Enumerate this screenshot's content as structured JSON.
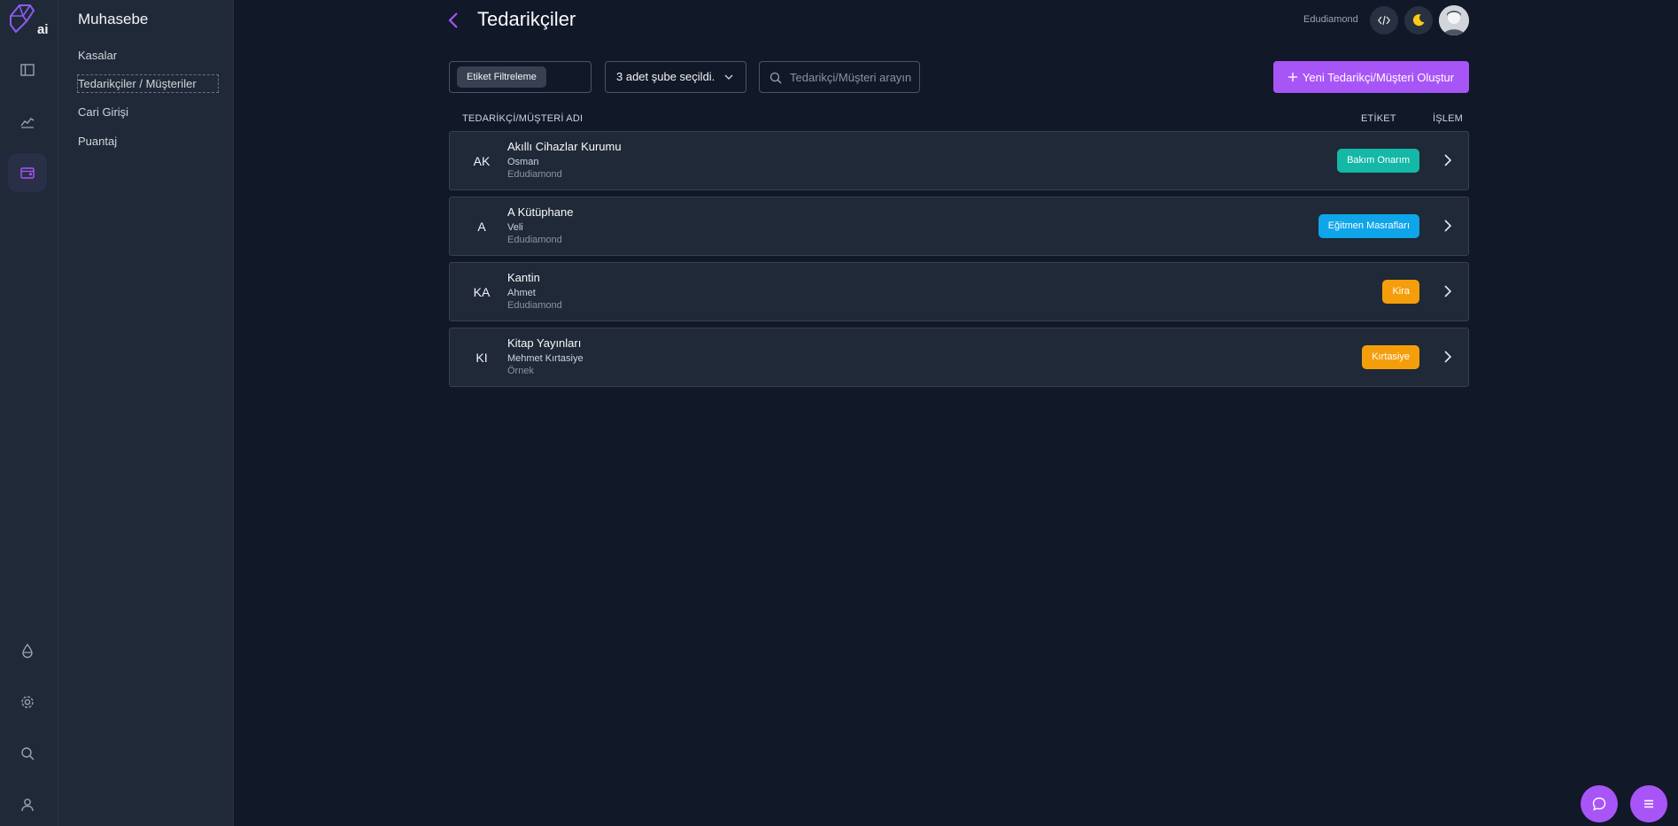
{
  "app": {
    "logo_text": "ai"
  },
  "subnav": {
    "title": "Muhasebe",
    "items": [
      {
        "label": "Kasalar"
      },
      {
        "label": "Tedarikçiler / Müşteriler"
      },
      {
        "label": "Cari Girişi"
      },
      {
        "label": "Puantaj"
      }
    ]
  },
  "header": {
    "title": "Tedarikçiler",
    "org_name": "Edudiamond"
  },
  "toolbar": {
    "tag_filter_label": "Etiket Filtreleme",
    "branch_select_label": "3 adet şube seçildi.",
    "search_placeholder": "Tedarikçi/Müşteri arayın",
    "new_button_label": "Yeni Tedarikçi/Müşteri Oluştur"
  },
  "table": {
    "columns": {
      "name": "TEDARİKÇİ/MÜŞTERİ ADI",
      "tag": "ETİKET",
      "action": "İŞLEM"
    },
    "rows": [
      {
        "initials": "AK",
        "name": "Akıllı Cihazlar Kurumu",
        "contact": "Osman",
        "branch": "Edudiamond",
        "tag": "Bakım Onarım",
        "tag_color": "#14b8a6"
      },
      {
        "initials": "A",
        "name": "A Kütüphane",
        "contact": "Veli",
        "branch": "Edudiamond",
        "tag": "Eğitmen Masrafları",
        "tag_color": "#0ea5e9"
      },
      {
        "initials": "KA",
        "name": "Kantin",
        "contact": "Ahmet",
        "branch": "Edudiamond",
        "tag": "Kira",
        "tag_color": "#f59e0b"
      },
      {
        "initials": "KI",
        "name": "Kitap Yayınları",
        "contact": "Mehmet  Kırtasiye",
        "branch": "Örnek",
        "tag": "Kırtasiye",
        "tag_color": "#f59e0b"
      }
    ]
  },
  "colors": {
    "accent": "#a855f7",
    "background": "#111827",
    "panel": "#1f2937"
  },
  "icons": {
    "rail": [
      "sidebar-panel-icon",
      "chart-line-icon",
      "wallet-icon",
      "drop-icon",
      "gear-icon",
      "search-icon",
      "user-icon"
    ],
    "header": [
      "code-icon",
      "moon-icon"
    ],
    "fab": [
      "chat-icon",
      "menu-icon"
    ]
  }
}
